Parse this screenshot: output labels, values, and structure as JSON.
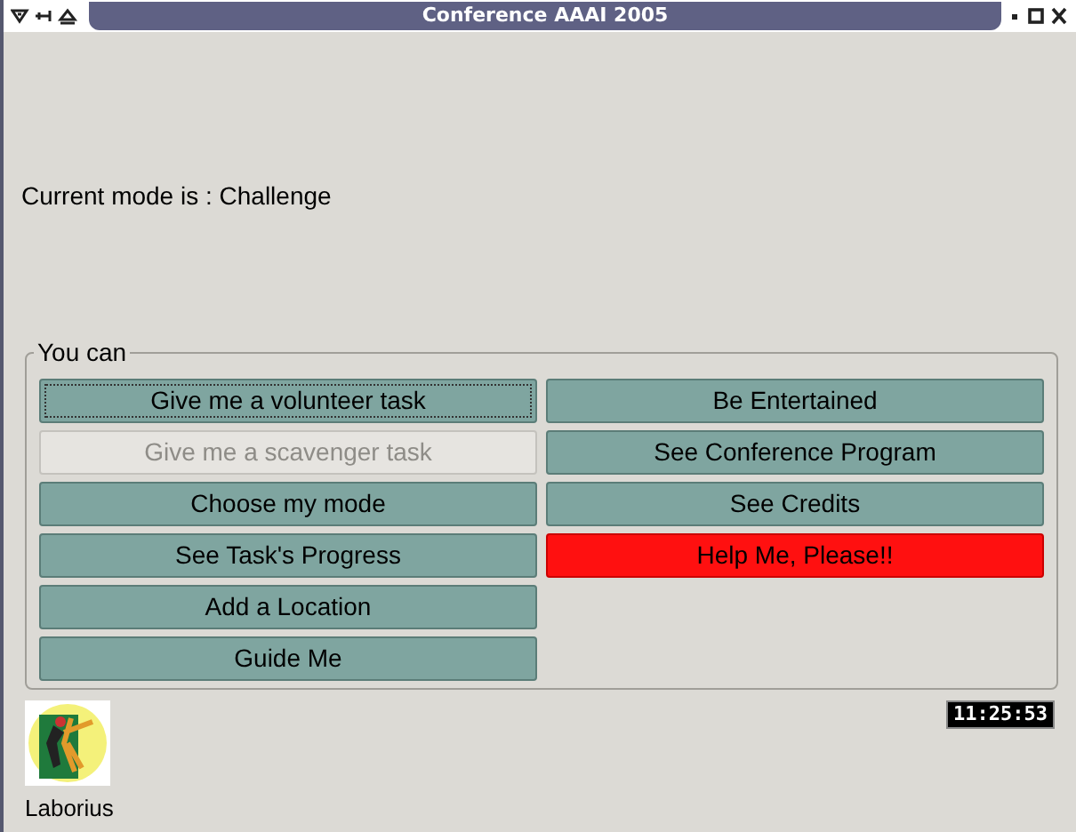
{
  "window": {
    "title": "Conference AAAI 2005"
  },
  "mode_text": "Current mode is : Challenge",
  "group": {
    "title": "You can",
    "columns": [
      [
        {
          "label": "Give me a volunteer task",
          "kind": "normal",
          "disabled": false,
          "focused": true
        },
        {
          "label": "Give me a scavenger task",
          "kind": "normal",
          "disabled": true,
          "focused": false
        },
        {
          "label": "Choose my mode",
          "kind": "normal",
          "disabled": false,
          "focused": false
        },
        {
          "label": "See Task's Progress",
          "kind": "normal",
          "disabled": false,
          "focused": false
        },
        {
          "label": "Add a Location",
          "kind": "normal",
          "disabled": false,
          "focused": false
        },
        {
          "label": "Guide Me",
          "kind": "normal",
          "disabled": false,
          "focused": false
        }
      ],
      [
        {
          "label": "Be Entertained",
          "kind": "normal",
          "disabled": false,
          "focused": false
        },
        {
          "label": "See Conference Program",
          "kind": "normal",
          "disabled": false,
          "focused": false
        },
        {
          "label": "See Credits",
          "kind": "normal",
          "disabled": false,
          "focused": false
        },
        {
          "label": "Help Me, Please!!",
          "kind": "alert",
          "disabled": false,
          "focused": false
        }
      ]
    ]
  },
  "logo": {
    "caption": "Laborius"
  },
  "clock": "11:25:53"
}
